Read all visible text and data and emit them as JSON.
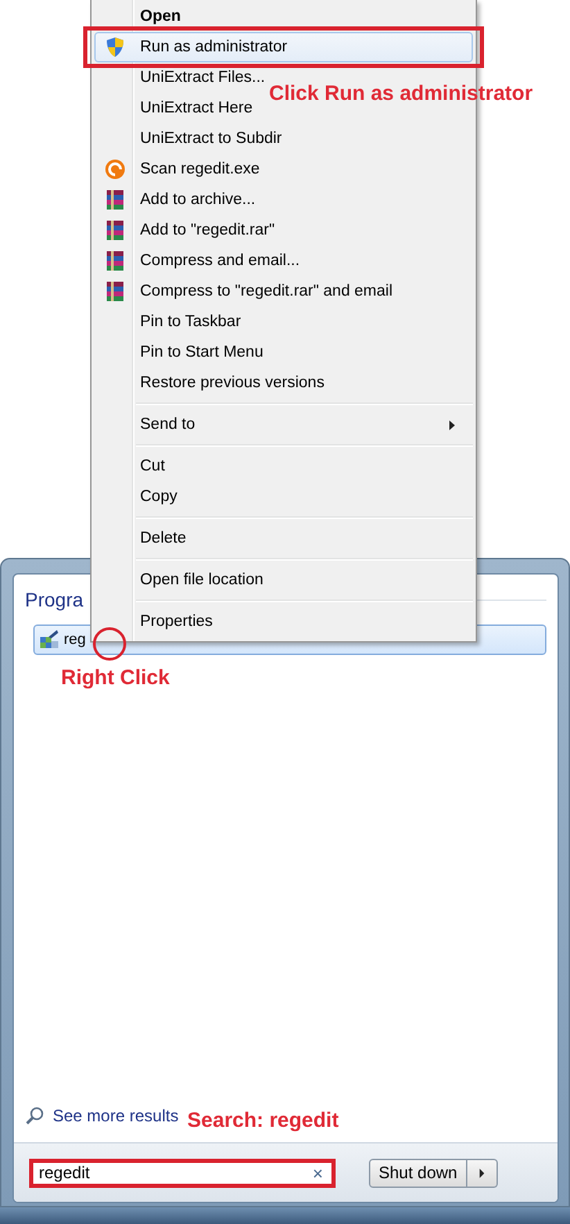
{
  "context_menu": {
    "items": [
      {
        "kind": "default",
        "label": "Open",
        "selected": false
      },
      {
        "kind": "shield",
        "label": "Run as administrator",
        "selected": true
      },
      {
        "kind": "plain",
        "label": "UniExtract Files...",
        "selected": false
      },
      {
        "kind": "plain",
        "label": "UniExtract Here",
        "selected": false
      },
      {
        "kind": "plain",
        "label": "UniExtract to Subdir",
        "selected": false
      },
      {
        "kind": "scan",
        "label": "Scan regedit.exe",
        "selected": false
      },
      {
        "kind": "archive",
        "label": "Add to archive...",
        "selected": false
      },
      {
        "kind": "archive",
        "label": "Add to \"regedit.rar\"",
        "selected": false
      },
      {
        "kind": "archive",
        "label": "Compress and email...",
        "selected": false
      },
      {
        "kind": "archive",
        "label": "Compress to \"regedit.rar\" and email",
        "selected": false
      },
      {
        "kind": "plain",
        "label": "Pin to Taskbar",
        "selected": false
      },
      {
        "kind": "plain",
        "label": "Pin to Start Menu",
        "selected": false
      },
      {
        "kind": "plain",
        "label": "Restore previous versions",
        "selected": false
      },
      {
        "kind": "separator"
      },
      {
        "kind": "submenu",
        "label": "Send to",
        "selected": false
      },
      {
        "kind": "separator"
      },
      {
        "kind": "plain",
        "label": "Cut",
        "selected": false
      },
      {
        "kind": "plain",
        "label": "Copy",
        "selected": false
      },
      {
        "kind": "separator"
      },
      {
        "kind": "plain",
        "label": "Delete",
        "selected": false
      },
      {
        "kind": "separator"
      },
      {
        "kind": "plain",
        "label": "Open file location",
        "selected": false
      },
      {
        "kind": "separator"
      },
      {
        "kind": "plain",
        "label": "Properties",
        "selected": false
      }
    ]
  },
  "start_menu": {
    "section_title": "Progra",
    "results": [
      {
        "label": "reg",
        "selected": true
      }
    ],
    "see_more": "See more results",
    "search": {
      "value": "regedit",
      "clear": "×"
    },
    "shutdown": {
      "label": "Shut down"
    }
  },
  "annotations": {
    "menu_note": "Click Run as administrator",
    "result_note": "Right Click",
    "search_note": "Search: regedit"
  }
}
